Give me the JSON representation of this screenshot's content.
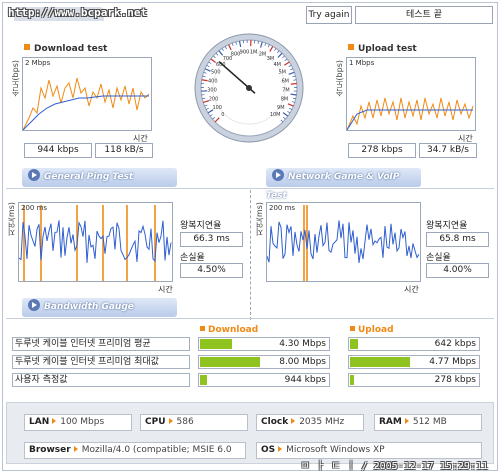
{
  "watermark": "http://www.bcpark.net",
  "header": {
    "try_again": "Try again",
    "status": "테스트 끝"
  },
  "download": {
    "title": "Download test",
    "scale": "2 Mbps",
    "ylabel": "속도(bps)",
    "xlabel": "시간",
    "rate": "944 kbps",
    "bytes": "118 kB/s"
  },
  "upload": {
    "title": "Upload test",
    "scale": "1 Mbps",
    "ylabel": "속도(bps)",
    "xlabel": "시간",
    "rate": "278 kbps",
    "bytes": "34.7 kB/s"
  },
  "gauge": {
    "ticks": [
      "0",
      "100",
      "200",
      "300",
      "400",
      "500",
      "600",
      "700",
      "800",
      "900",
      "1M",
      "2M",
      "3M",
      "4M",
      "5M",
      "6M",
      "7M",
      "8M",
      "9M",
      "10M"
    ],
    "needle_fraction": 0.32
  },
  "ping": {
    "banner": "General Ping Test",
    "scale": "200 ms",
    "ylabel": "지연(ms)",
    "xlabel": "시간",
    "rtt_label": "왕복지연율",
    "rtt_value": "66.3 ms",
    "loss_label": "손실율",
    "loss_value": "4.50%"
  },
  "game": {
    "banner": "Network Game & VoIP Test",
    "scale": "200 ms",
    "ylabel": "지연(ms)",
    "xlabel": "시간",
    "rtt_label": "왕복지연율",
    "rtt_value": "65.8 ms",
    "loss_label": "손실율",
    "loss_value": "4.00%"
  },
  "bandwidth": {
    "banner": "Bandwidth Gauge",
    "download_header": "Download",
    "upload_header": "Upload",
    "rows": [
      {
        "label": "두루넷 케이블 인터넷 프리미엄 평균",
        "down": "4.30 Mbps",
        "down_fraction": 0.54,
        "up": "642 kbps",
        "up_fraction": 0.14
      },
      {
        "label": "두루넷 케이블 인터넷 프리미엄 최대값",
        "down": "8.00 Mbps",
        "down_fraction": 1.0,
        "up": "4.77 Mbps",
        "up_fraction": 1.0
      },
      {
        "label": "사용자 측정값",
        "down": "944 kbps",
        "down_fraction": 0.12,
        "up": "278 kbps",
        "up_fraction": 0.06
      }
    ]
  },
  "system": {
    "lan_label": "LAN",
    "lan_value": "100 Mbps",
    "cpu_label": "CPU",
    "cpu_value": "586",
    "clock_label": "Clock",
    "clock_value": "2035 MHz",
    "ram_label": "RAM",
    "ram_value": "512 MB",
    "browser_label": "Browser",
    "browser_value": "Mozilla/4.0 (compatible; MSIE 6.0",
    "os_label": "OS",
    "os_value": "Microsoft Windows XP"
  },
  "footer": "ㅁ ㅏ ㄷ ㅣ / 2005-12-17 15:29:11",
  "colors": {
    "orange": "#f08a16",
    "blue": "#2f5fd0",
    "bar_green": "#8fc31f",
    "banner_blue": "#b9cbe9"
  }
}
